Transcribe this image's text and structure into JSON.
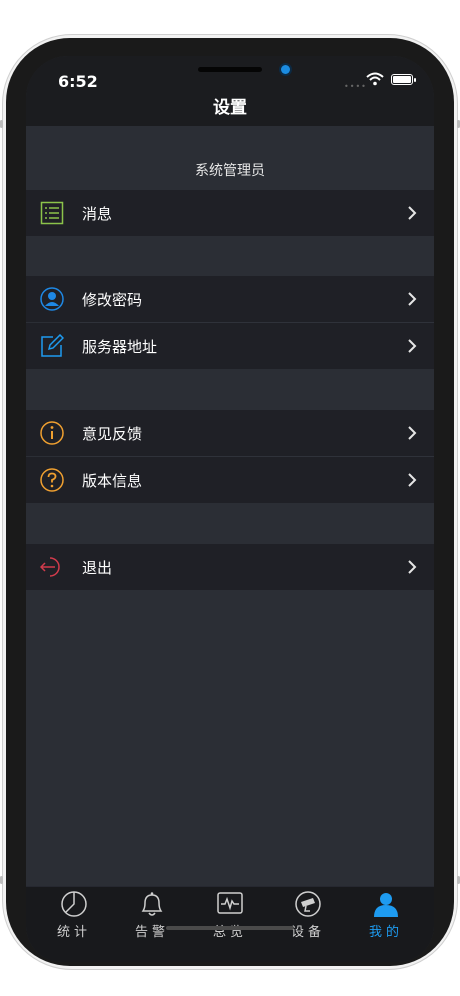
{
  "status_bar": {
    "time": "6:52"
  },
  "nav": {
    "title": "设置"
  },
  "section_header": "系统管理员",
  "menu_items": [
    {
      "label": "消息",
      "icon": "list-icon",
      "icon_color": "#8bc34a"
    },
    {
      "label": "修改密码",
      "icon": "user-icon",
      "icon_color": "#1e88e5"
    },
    {
      "label": "服务器地址",
      "icon": "edit-icon",
      "icon_color": "#1e9bf0"
    },
    {
      "label": "意见反馈",
      "icon": "info-icon",
      "icon_color": "#f0a030"
    },
    {
      "label": "版本信息",
      "icon": "question-icon",
      "icon_color": "#f0a030"
    },
    {
      "label": "退出",
      "icon": "logout-icon",
      "icon_color": "#d23b4c"
    }
  ],
  "tabs": [
    {
      "label": "统计",
      "icon": "pie-chart-icon",
      "active": false
    },
    {
      "label": "告警",
      "icon": "bell-icon",
      "active": false
    },
    {
      "label": "总览",
      "icon": "monitor-icon",
      "active": false
    },
    {
      "label": "设备",
      "icon": "camera-icon",
      "active": false
    },
    {
      "label": "我的",
      "icon": "person-icon",
      "active": true
    }
  ],
  "colors": {
    "background": "#2b2e35",
    "row": "#1f2026",
    "accent": "#1e9bf0",
    "topbar": "#1b1c1f"
  }
}
